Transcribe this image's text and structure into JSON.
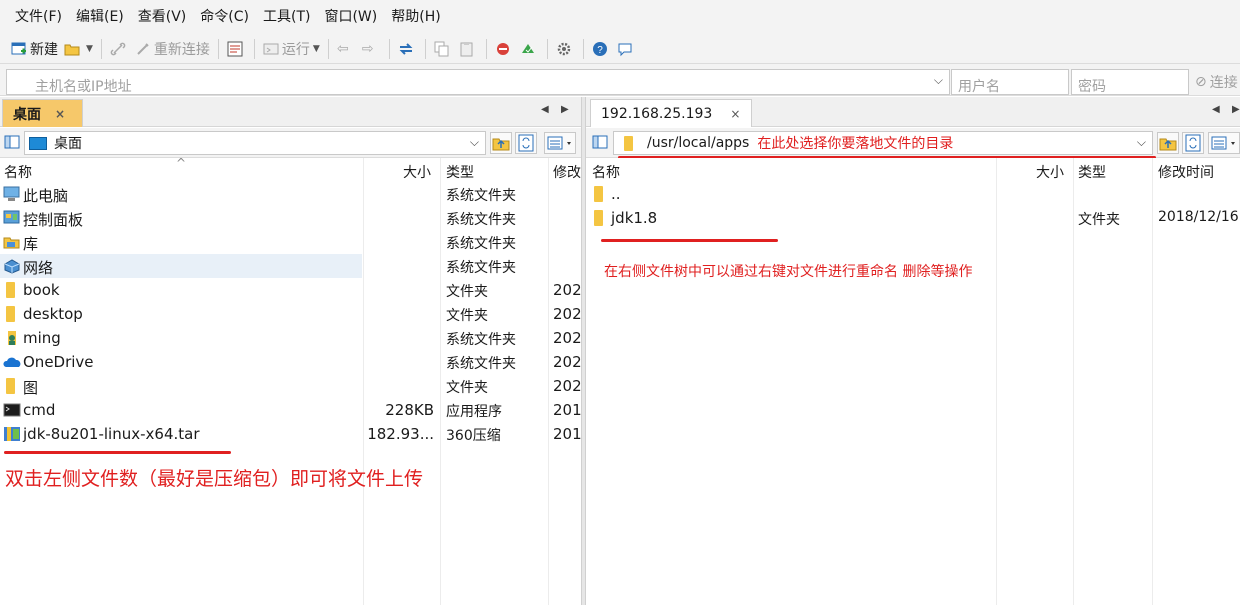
{
  "menu": [
    "文件(F)",
    "编辑(E)",
    "查看(V)",
    "命令(C)",
    "工具(T)",
    "窗口(W)",
    "帮助(H)"
  ],
  "toolbar": {
    "new_label": "新建",
    "reconnect_label": "重新连接",
    "run_label": "运行"
  },
  "address": {
    "host_placeholder": "主机名或IP地址",
    "user_placeholder": "用户名",
    "password_placeholder": "密码",
    "connect_label": "连接"
  },
  "left": {
    "tab_label": "桌面",
    "path": "桌面",
    "columns": {
      "name": "名称",
      "size": "大小",
      "type": "类型",
      "modified": "修改"
    },
    "rows": [
      {
        "name": "此电脑",
        "size": "",
        "type": "系统文件夹",
        "modified": "",
        "icon": "computer-icon"
      },
      {
        "name": "控制面板",
        "size": "",
        "type": "系统文件夹",
        "modified": "",
        "icon": "control-panel-icon"
      },
      {
        "name": "库",
        "size": "",
        "type": "系统文件夹",
        "modified": "",
        "icon": "library-icon"
      },
      {
        "name": "网络",
        "size": "",
        "type": "系统文件夹",
        "modified": "",
        "icon": "network-icon"
      },
      {
        "name": "book",
        "size": "",
        "type": "文件夹",
        "modified": "202",
        "icon": "folder-icon"
      },
      {
        "name": "desktop",
        "size": "",
        "type": "文件夹",
        "modified": "202",
        "icon": "folder-icon"
      },
      {
        "name": "ming",
        "size": "",
        "type": "系统文件夹",
        "modified": "202",
        "icon": "user-folder-icon"
      },
      {
        "name": "OneDrive",
        "size": "",
        "type": "系统文件夹",
        "modified": "202",
        "icon": "cloud-icon"
      },
      {
        "name": "图",
        "size": "",
        "type": "文件夹",
        "modified": "202",
        "icon": "folder-icon"
      },
      {
        "name": "cmd",
        "size": "228KB",
        "type": "应用程序",
        "modified": "201",
        "icon": "terminal-icon"
      },
      {
        "name": "jdk-8u201-linux-x64.tar",
        "size": "182.93...",
        "type": "360压缩",
        "modified": "201",
        "icon": "archive-icon"
      }
    ],
    "annotation": "双击左侧文件数（最好是压缩包）即可将文件上传"
  },
  "right": {
    "tab_label": "192.168.25.193",
    "path": "/usr/local/apps",
    "path_annotation": "在此处选择你要落地文件的目录",
    "columns": {
      "name": "名称",
      "size": "大小",
      "type": "类型",
      "modified": "修改时间"
    },
    "rows": [
      {
        "name": "..",
        "size": "",
        "type": "",
        "modified": ""
      },
      {
        "name": "jdk1.8",
        "size": "",
        "type": "文件夹",
        "modified": "2018/12/16"
      }
    ],
    "annotation": "在右侧文件树中可以通过右键对文件进行重命名 删除等操作"
  },
  "colors": {
    "annotation": "#e02020",
    "selected_row": "#e8f0f8",
    "folder": "#f4c542"
  }
}
